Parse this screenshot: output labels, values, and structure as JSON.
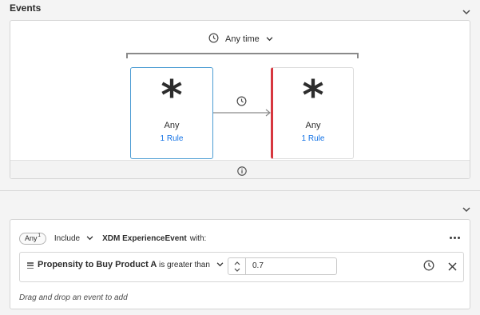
{
  "events_section": {
    "title": "Events",
    "time_selector": {
      "label": "Any time"
    },
    "cards": [
      {
        "name": "Any",
        "rule": "1 Rule"
      },
      {
        "name": "Any",
        "rule": "1 Rule"
      }
    ]
  },
  "rule_section": {
    "any_badge": "Any",
    "any_badge_count": "1",
    "include_label": "Include",
    "event_type": "XDM ExperienceEvent",
    "with_label": "with:",
    "condition": {
      "attribute": "Propensity to Buy Product A",
      "operator": "is greater than",
      "value": "0.7"
    },
    "drag_hint": "Drag and drop an event to add"
  },
  "icons": {
    "collapse": "chevron-down-icon",
    "time": "clock-icon",
    "info": "info-icon",
    "more": "more-icon",
    "remove": "close-icon"
  },
  "colors": {
    "accent": "#1473e6",
    "selected_border": "#4b9cd3",
    "marker_red": "#d7373f"
  }
}
